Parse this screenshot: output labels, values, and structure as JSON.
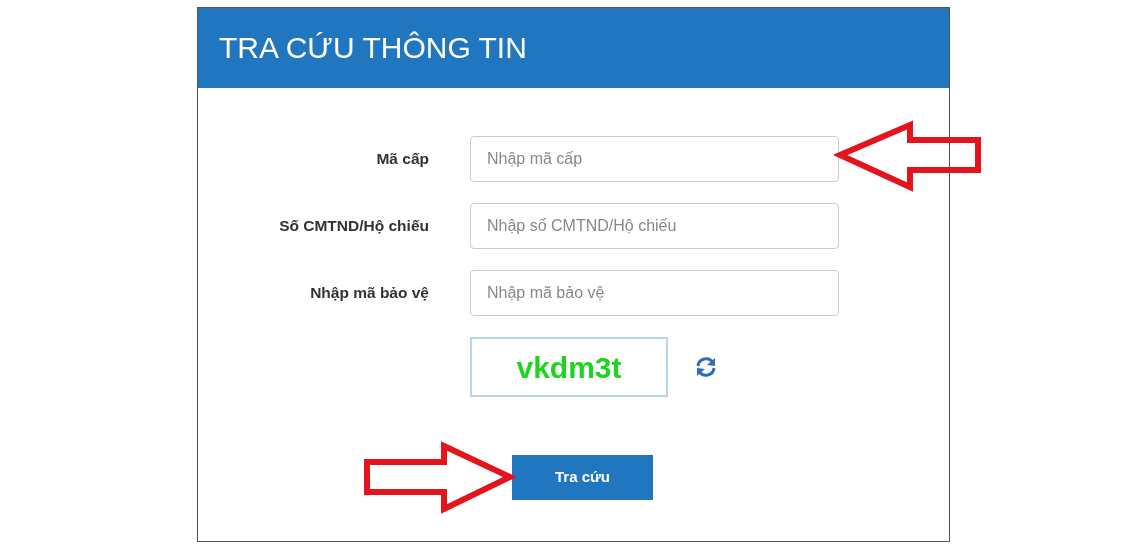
{
  "panel": {
    "title": "TRA CỨU THÔNG TIN"
  },
  "fields": [
    {
      "label": "Mã cấp",
      "placeholder": "Nhập mã cấp"
    },
    {
      "label": "Số CMTND/Hộ chiếu",
      "placeholder": "Nhập số CMTND/Hộ chiếu"
    },
    {
      "label": "Nhập mã bảo vệ",
      "placeholder": "Nhập mã bảo vệ"
    }
  ],
  "captcha": {
    "code": "vkdm3t"
  },
  "submit_button": {
    "label": "Tra cứu"
  }
}
